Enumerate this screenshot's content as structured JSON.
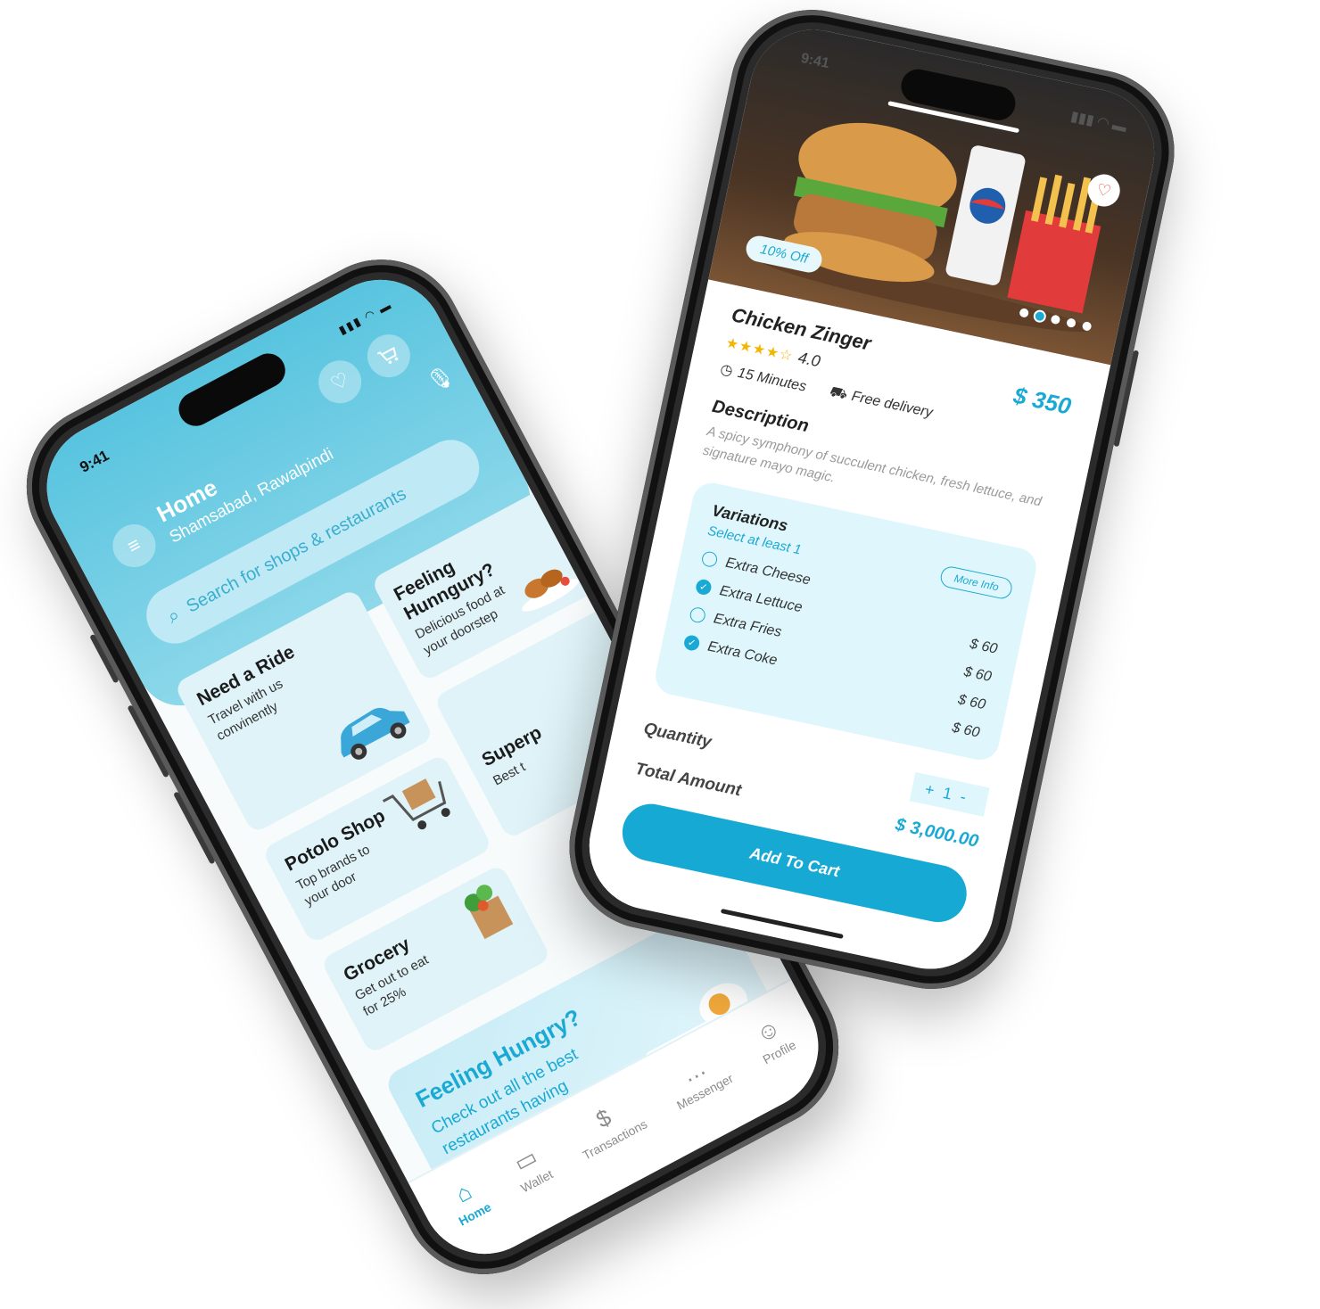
{
  "colors": {
    "accent": "#1aa9d4",
    "header_gradient_start": "#58c4df",
    "card_bg": "#dff3f8",
    "star": "#f5b400"
  },
  "home": {
    "status": {
      "time": "9:41"
    },
    "header": {
      "title": "Home",
      "location": "Shamsabad, Rawalpindi",
      "menu_icon": "menu-icon",
      "favorite_icon": "heart-icon",
      "cart_icon": "cart-icon",
      "mic_icon": "mic-icon"
    },
    "search": {
      "placeholder": "Search for shops & restaurants",
      "icon": "search-icon"
    },
    "cards": [
      {
        "title": "Need a Ride",
        "subtitle": "Travel with us convinently"
      },
      {
        "title": "Feeling Hunngury?",
        "subtitle": "Delicious food at your doorstep"
      },
      {
        "title": "Potolo Shop",
        "subtitle": "Top brands to your door"
      },
      {
        "title": "Superp",
        "subtitle": "Best t"
      },
      {
        "title": "Grocery",
        "subtitle": "Get out to eat for 25%"
      }
    ],
    "banner": {
      "title": "Feeling Hungry?",
      "subtitle": "Check out all the best restaurants having delicious food!"
    },
    "nav": [
      {
        "label": "Home",
        "icon": "home-icon",
        "glyph": "⌂",
        "active": true
      },
      {
        "label": "Wallet",
        "icon": "wallet-icon",
        "glyph": "▭",
        "active": false
      },
      {
        "label": "Transactions",
        "icon": "dollar-circle-icon",
        "glyph": "$",
        "active": false
      },
      {
        "label": "Messenger",
        "icon": "chat-icon",
        "glyph": "…",
        "active": false
      },
      {
        "label": "Profile",
        "icon": "user-icon",
        "glyph": "☺",
        "active": false
      }
    ]
  },
  "detail": {
    "status": {
      "time": "9:41"
    },
    "badge": "10% Off",
    "favorite_icon": "heart-icon",
    "name": "Chicken Zinger",
    "rating": "4.0",
    "stars": "★★★★☆",
    "price": "$ 350",
    "time": "15 Minutes",
    "delivery": "Free delivery",
    "clock_icon": "clock-icon",
    "scooter_icon": "scooter-icon",
    "description_heading": "Description",
    "description": "A spicy symphony of succulent chicken, fresh lettuce, and signature mayo magic.",
    "variations": {
      "heading": "Variations",
      "subheading": "Select at least 1",
      "more_info": "More Info",
      "options": [
        {
          "label": "Extra Cheese",
          "price": "",
          "selected": false
        },
        {
          "label": "Extra Lettuce",
          "price": "$ 60",
          "selected": true
        },
        {
          "label": "Extra Fries",
          "price": "$ 60",
          "selected": false
        },
        {
          "label": "Extra Coke",
          "price": "$ 60",
          "selected": true
        }
      ],
      "extra_price": "$ 60"
    },
    "quantity_label": "Quantity",
    "quantity": {
      "plus": "+",
      "value": "1",
      "minus": "-"
    },
    "total_label": "Total Amount",
    "total": "$ 3,000.00",
    "add_to_cart": "Add To Cart"
  }
}
